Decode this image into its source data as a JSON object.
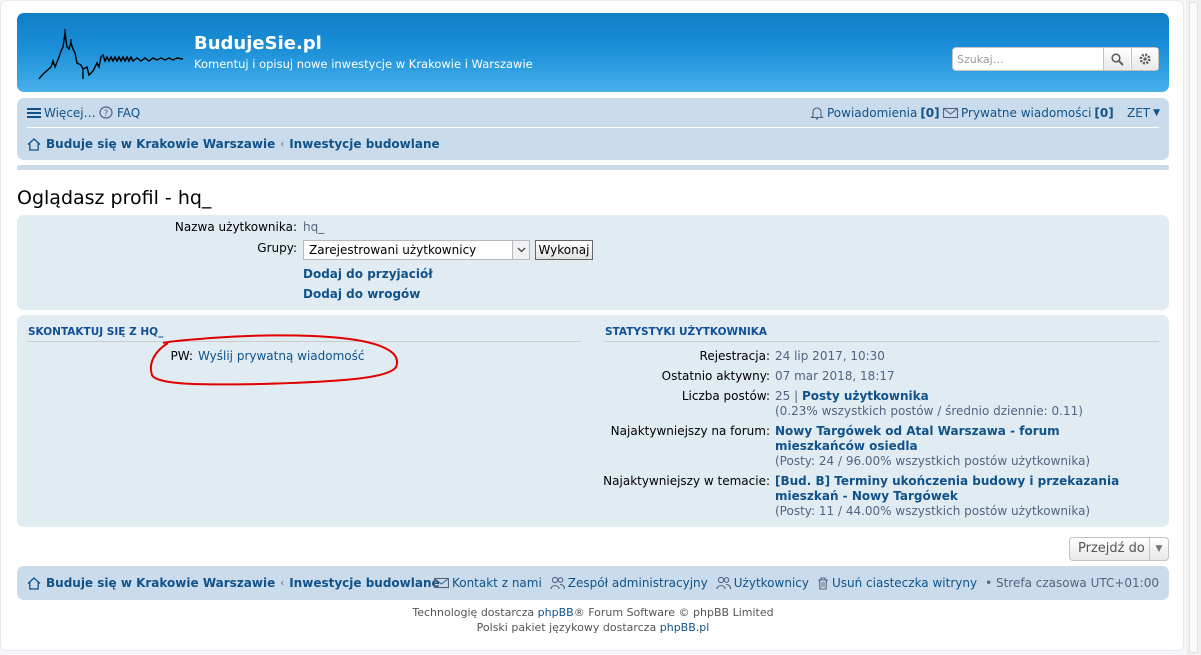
{
  "site": {
    "title": "BudujeSie.pl",
    "description": "Komentuj i opisuj nowe inwestycje w Krakowie i Warszawie",
    "search_placeholder": "Szukaj…"
  },
  "navbar": {
    "more": "Więcej…",
    "faq": "FAQ",
    "notifications": "Powiadomienia",
    "notifications_count": "[0]",
    "messages": "Prywatne wiadomości",
    "messages_count": "[0]",
    "user": "ZET"
  },
  "breadcrumb": {
    "home": "Buduje się w Krakowie Warszawie",
    "section": "Inwestycje budowlane"
  },
  "page_title": "Oglądasz profil - hq_",
  "profile": {
    "username_label": "Nazwa użytkownika:",
    "username": "hq_",
    "groups_label": "Grupy:",
    "group_selected": "Zarejestrowani użytkownicy",
    "go_button": "Wykonaj",
    "add_friend": "Dodaj do przyjaciół",
    "add_foe": "Dodaj do wrogów"
  },
  "contact": {
    "heading": "Skontaktuj się z hq_",
    "pm_label": "PW:",
    "pm_link": "Wyślij prywatną wiadomość"
  },
  "stats": {
    "heading": "Statystyki użytkownika",
    "registered_label": "Rejestracja:",
    "registered": "24 lip 2017, 10:30",
    "last_active_label": "Ostatnio aktywny:",
    "last_active": "07 mar 2018, 18:17",
    "posts_label": "Liczba postów:",
    "posts_count": "25 |",
    "posts_link": "Posty użytkownika",
    "posts_detail": "(0.23% wszystkich postów / średnio dziennie: 0.11)",
    "active_forum_label": "Najaktywniejszy na forum:",
    "active_forum_line1": "Nowy Targówek od Atal Warszawa - forum",
    "active_forum_line2": "mieszkańców osiedla",
    "active_forum_detail": "(Posty: 24 / 96.00% wszystkich postów użytkownika)",
    "active_topic_label": "Najaktywniejszy w temacie:",
    "active_topic_line1": "[Bud. B] Terminy ukończenia budowy i przekazania",
    "active_topic_line2": "mieszkań - Nowy Targówek",
    "active_topic_detail": "(Posty: 11 / 44.00% wszystkich postów użytkownika)"
  },
  "jump_to": "Przejdź do",
  "footer": {
    "contact": "Kontakt z nami",
    "team": "Zespół administracyjny",
    "members": "Użytkownicy",
    "delete_cookies": "Usuń ciasteczka witryny",
    "timezone": "• Strefa czasowa UTC+01:00",
    "powered_prefix": "Technologię dostarcza",
    "powered_link": "phpBB",
    "powered_suffix": "® Forum Software © phpBB Limited",
    "lang_prefix": "Polski pakiet językowy dostarcza",
    "lang_link": "phpBB.pl"
  },
  "colors": {
    "header": "#1b8fd8",
    "nav_bg": "#cadceb",
    "panel_bg": "#e1ebf2",
    "link": "#105289",
    "annotation": "#e00000"
  },
  "icons": [
    "hamburger-icon",
    "help-icon",
    "bell-icon",
    "envelope-icon",
    "home-icon",
    "search-icon",
    "gear-icon",
    "users-icon",
    "trash-icon"
  ]
}
